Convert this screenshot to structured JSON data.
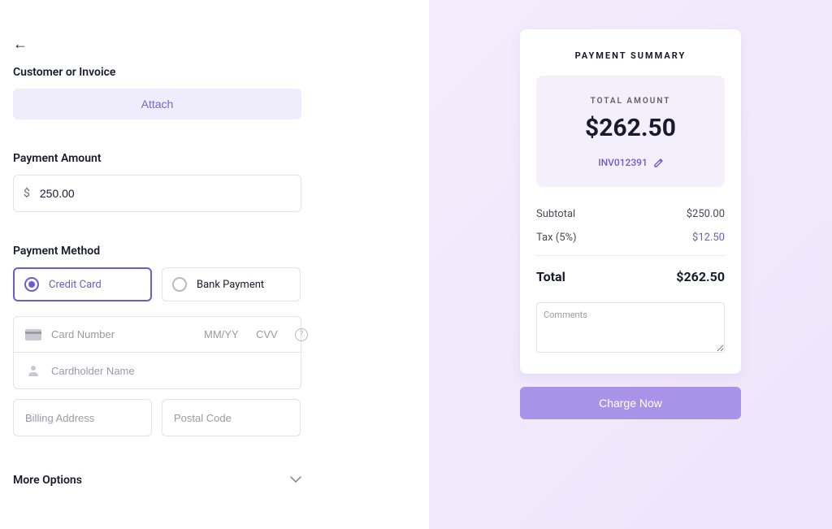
{
  "left": {
    "customer_section": {
      "label": "Customer or Invoice",
      "attach_label": "Attach"
    },
    "amount_section": {
      "label": "Payment Amount",
      "currency": "$",
      "value": "250.00"
    },
    "method_section": {
      "label": "Payment Method",
      "options": [
        {
          "label": "Credit Card",
          "selected": true
        },
        {
          "label": "Bank Payment",
          "selected": false
        }
      ],
      "card_number_placeholder": "Card Number",
      "mm_yy_placeholder": "MM/YY",
      "cvv_placeholder": "CVV",
      "cardholder_placeholder": "Cardholder Name",
      "billing_placeholder": "Billing Address",
      "postal_placeholder": "Postal Code"
    },
    "more_options_label": "More Options"
  },
  "right": {
    "summary_title": "PAYMENT SUMMARY",
    "total_label": "TOTAL AMOUNT",
    "total_amount": "$262.50",
    "invoice_id": "INV012391",
    "subtotal_label": "Subtotal",
    "subtotal_value": "$250.00",
    "tax_label": "Tax (5%)",
    "tax_value": "$12.50",
    "total_line_label": "Total",
    "total_line_value": "$262.50",
    "comments_placeholder": "Comments",
    "charge_label": "Charge Now"
  }
}
